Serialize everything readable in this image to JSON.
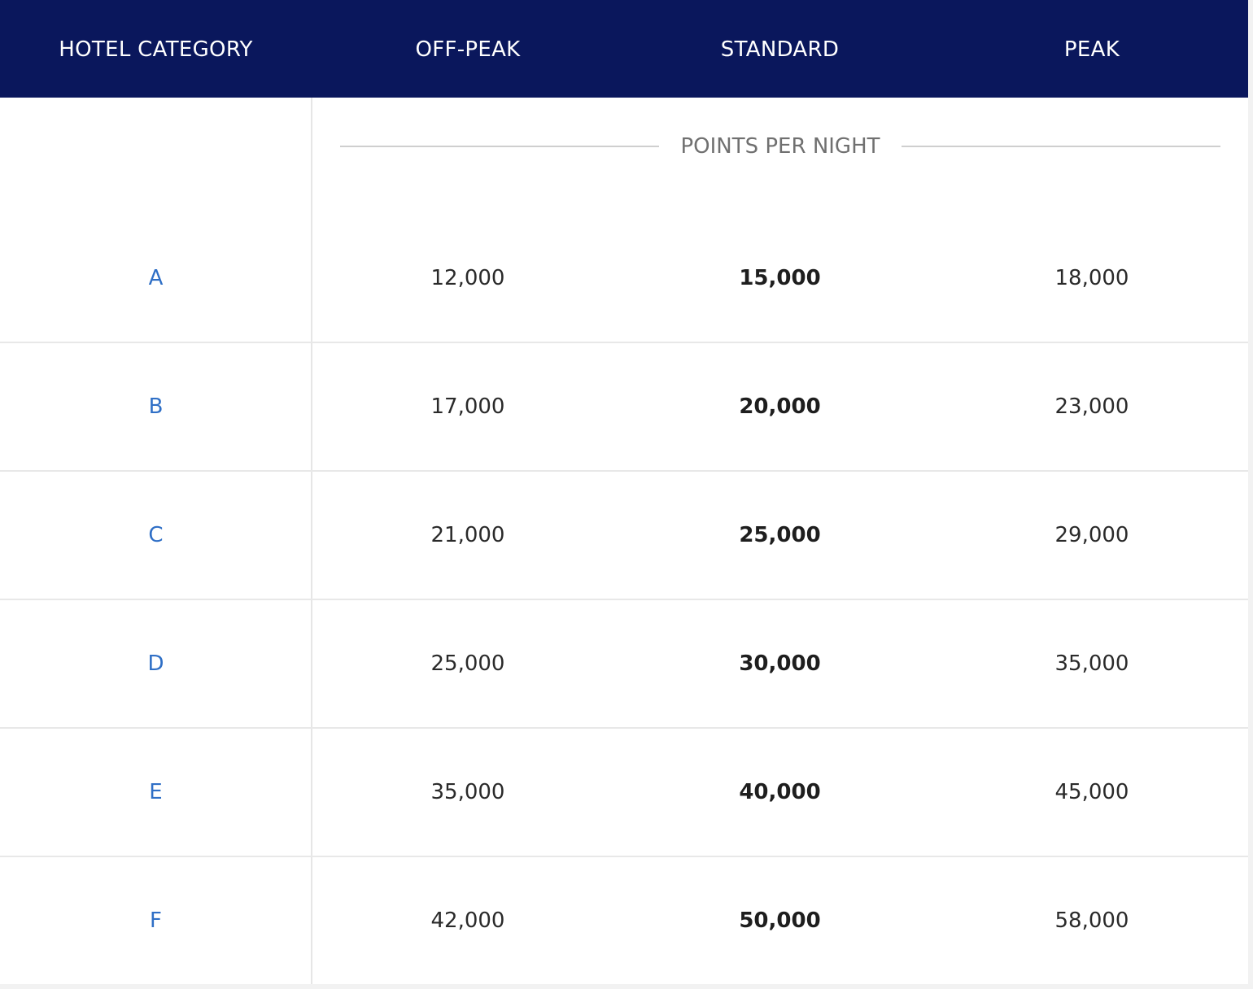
{
  "header": {
    "columns": [
      "HOTEL CATEGORY",
      "OFF-PEAK",
      "STANDARD",
      "PEAK"
    ]
  },
  "subheader": {
    "label": "POINTS PER NIGHT"
  },
  "rows": [
    {
      "category": "A",
      "off_peak": "12,000",
      "standard": "15,000",
      "peak": "18,000"
    },
    {
      "category": "B",
      "off_peak": "17,000",
      "standard": "20,000",
      "peak": "23,000"
    },
    {
      "category": "C",
      "off_peak": "21,000",
      "standard": "25,000",
      "peak": "29,000"
    },
    {
      "category": "D",
      "off_peak": "25,000",
      "standard": "30,000",
      "peak": "35,000"
    },
    {
      "category": "E",
      "off_peak": "35,000",
      "standard": "40,000",
      "peak": "45,000"
    },
    {
      "category": "F",
      "off_peak": "42,000",
      "standard": "50,000",
      "peak": "58,000"
    }
  ],
  "colors": {
    "header_background": "#0a175c",
    "header_text": "#ffffff",
    "category_link": "#2f6fc6",
    "subheader_text": "#707070"
  }
}
